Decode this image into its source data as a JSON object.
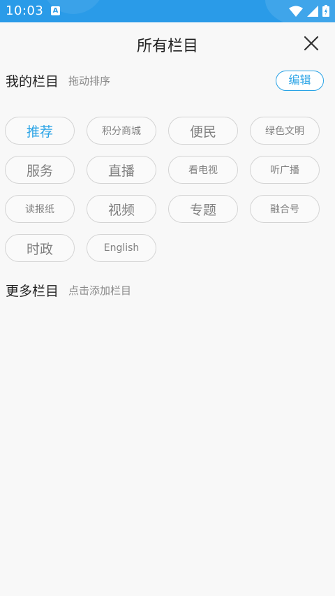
{
  "status_bar": {
    "time": "10:03",
    "bg_color": "#2a9be8",
    "icons": [
      "a-icon",
      "wifi-icon",
      "signal-icon",
      "battery-icon"
    ]
  },
  "header": {
    "title": "所有栏目"
  },
  "my_channels": {
    "title": "我的栏目",
    "hint": "拖动排序",
    "edit_label": "编辑"
  },
  "channels": [
    {
      "label": "推荐",
      "active": true
    },
    {
      "label": "积分商城",
      "small": true
    },
    {
      "label": "便民"
    },
    {
      "label": "绿色文明",
      "small": true
    },
    {
      "label": "服务"
    },
    {
      "label": "直播"
    },
    {
      "label": "看电视",
      "small": true
    },
    {
      "label": "听广播",
      "small": true
    },
    {
      "label": "读报纸",
      "small": true
    },
    {
      "label": "视频"
    },
    {
      "label": "专题"
    },
    {
      "label": "融合号",
      "small": true
    },
    {
      "label": "时政"
    },
    {
      "label": "English",
      "small": true
    }
  ],
  "more_channels": {
    "title": "更多栏目",
    "hint": "点击添加栏目"
  },
  "colors": {
    "accent": "#29a3e6",
    "chip_border": "#d4d4d4",
    "chip_text": "#808080"
  }
}
